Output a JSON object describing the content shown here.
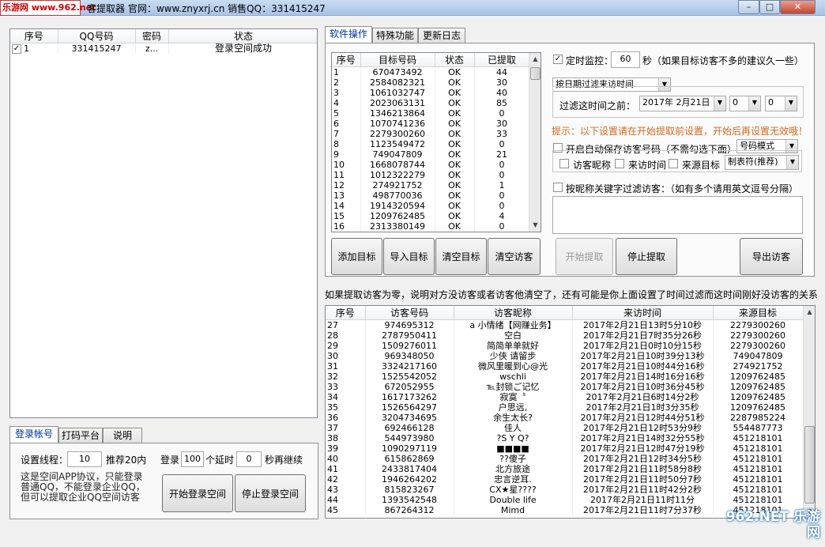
{
  "window": {
    "watermark": "乐游网 www.962.net",
    "title": "客提取器    官网：www.znyxrj.cn   销售QQ：331415247",
    "minimize": "–",
    "maximize": "□",
    "close": "✕"
  },
  "accounts": {
    "headers": [
      "序号",
      "QQ号码",
      "密码",
      "状态"
    ],
    "rows": [
      {
        "checked": "✓",
        "index": "1",
        "qq": "331415247",
        "password": "z...",
        "status": "登录空间成功"
      }
    ]
  },
  "left_tabs": [
    "登录帐号",
    "打码平台",
    "说明"
  ],
  "login": {
    "threads_label": "设置线程：",
    "threads_value": "10",
    "threads_hint": "推荐20内",
    "login_label": "登录",
    "login_value": "100",
    "delay_label": "个延时",
    "delay_value": "0",
    "delay_suffix": "秒再继续",
    "note": "这是空间APP协议，只能登录普通QQ，不能登录企业QQ，但可以提取企业QQ空间访客",
    "start_button": "开始登录空间",
    "stop_button": "停止登录空间"
  },
  "right_tabs": [
    "软件操作",
    "特殊功能",
    "更新日志"
  ],
  "targets": {
    "headers": [
      "序号",
      "目标号码",
      "状态",
      "已提取"
    ],
    "rows": [
      [
        "1",
        "670473492",
        "OK",
        "44"
      ],
      [
        "2",
        "2584082321",
        "OK",
        "30"
      ],
      [
        "3",
        "1061032747",
        "OK",
        "40"
      ],
      [
        "4",
        "2023063131",
        "OK",
        "85"
      ],
      [
        "5",
        "1346213864",
        "OK",
        "0"
      ],
      [
        "6",
        "1070741236",
        "OK",
        "30"
      ],
      [
        "7",
        "2279300260",
        "OK",
        "33"
      ],
      [
        "8",
        "1123549472",
        "OK",
        "0"
      ],
      [
        "9",
        "749047809",
        "OK",
        "21"
      ],
      [
        "10",
        "1668078744",
        "OK",
        "0"
      ],
      [
        "11",
        "1012322279",
        "OK",
        "0"
      ],
      [
        "12",
        "274921752",
        "OK",
        "1"
      ],
      [
        "13",
        "498770036",
        "OK",
        "0"
      ],
      [
        "14",
        "1914320594",
        "OK",
        "0"
      ],
      [
        "15",
        "1209762485",
        "OK",
        "4"
      ],
      [
        "16",
        "2313380149",
        "OK",
        "0"
      ]
    ]
  },
  "options": {
    "monitor_label": "定时监控：",
    "monitor_value": "60",
    "monitor_suffix": "秒（如果目标访客不多的建议久一些）",
    "filter_mode": "按日期过滤来访时间",
    "filter_before_label": "过滤这时间之前：",
    "filter_date": "2017年 2月21日",
    "filter_hour": "0",
    "filter_min": "0",
    "warning": "提示：以下设置请在开始提取前设置，开始后再设置无效哦！",
    "autosave_label": "开启自动保存访客号码（不需勾选下面）",
    "save_mode": "号码模式",
    "nick_label": "访客昵称",
    "time_label": "来访时间",
    "source_label": "来源目标",
    "separator": "制表符(推荐)",
    "keyword_label": "按昵称关键字过滤访客：（如有多个请用英文逗号分隔）"
  },
  "buttons": {
    "add_target": "添加目标",
    "import_target": "导入目标",
    "clear_target": "清空目标",
    "clear_visitor": "清空访客",
    "start_extract": "开始提取",
    "stop_extract": "停止提取",
    "export_visitor": "导出访客"
  },
  "info_line": "如果提取访客为零，说明对方没访客或者访客他清空了，还有可能是你上面设置了时间过滤而这时间刚好没访客的关系",
  "visitors": {
    "headers": [
      "序号",
      "访客号码",
      "访客昵称",
      "来访时间",
      "来源目标"
    ],
    "rows": [
      [
        "27",
        "974695312",
        "a  小情绪【网赚业务】",
        "2017年2月21日13时5分10秒",
        "2279300260"
      ],
      [
        "28",
        "2787950411",
        "空白",
        "2017年2月21日7时35分26秒",
        "2279300260"
      ],
      [
        "29",
        "1509276011",
        "简简单单就好",
        "2017年2月21日0时10分15秒",
        "2279300260"
      ],
      [
        "30",
        "969348050",
        "少侠 请留步",
        "2017年2月21日10时39分13秒",
        "749047809"
      ],
      [
        "31",
        "3324217160",
        "微风里暖到心@光",
        "2017年2月21日10时44分16秒",
        "274921752"
      ],
      [
        "32",
        "1525542052",
        "wschli",
        "2017年2月21日14时16分16秒",
        "1209762485"
      ],
      [
        "33",
        "672052955",
        "℡封锁ご记忆",
        "2017年2月21日10时36分45秒",
        "1209762485"
      ],
      [
        "34",
        "1617173262",
        "寂寞〝",
        "2017年2月21日6时14分2秒",
        "1209762485"
      ],
      [
        "35",
        "1526564297",
        "户思远,",
        "2017年2月21日1时3分35秒",
        "1209762485"
      ],
      [
        "36",
        "3204734695",
        "余生太长?",
        "2017年2月21日12时44分51秒",
        "2287985224"
      ],
      [
        "37",
        "692466128",
        "佳人",
        "2017年2月21日12时53分9秒",
        "554487773"
      ],
      [
        "38",
        "544973980",
        "?S Y Q?",
        "2017年2月21日14时32分55秒",
        "451218101"
      ],
      [
        "39",
        "1090297119",
        "■■■■",
        "2017年2月21日12时47分19秒",
        "451218101"
      ],
      [
        "40",
        "615862869",
        "??傻子",
        "2017年2月21日12时34分5秒",
        "451218101"
      ],
      [
        "41",
        "2433817404",
        "北方旅途",
        "2017年2月21日11时58分8秒",
        "451218101"
      ],
      [
        "42",
        "1946264202",
        "忠言逆耳.",
        "2017年2月21日11时50分7秒",
        "451218101"
      ],
      [
        "43",
        "815823267",
        "CX★星????",
        "2017年2月21日11时42分2秒",
        "451218101"
      ],
      [
        "44",
        "1393542548",
        "Double life",
        "2017年2月21日11时11分",
        "451218101"
      ],
      [
        "45",
        "867264312",
        "Mimd",
        "2017年2月21日11时7分37秒",
        "451218101"
      ]
    ]
  },
  "corner_watermark": "962.NET 乐游网"
}
